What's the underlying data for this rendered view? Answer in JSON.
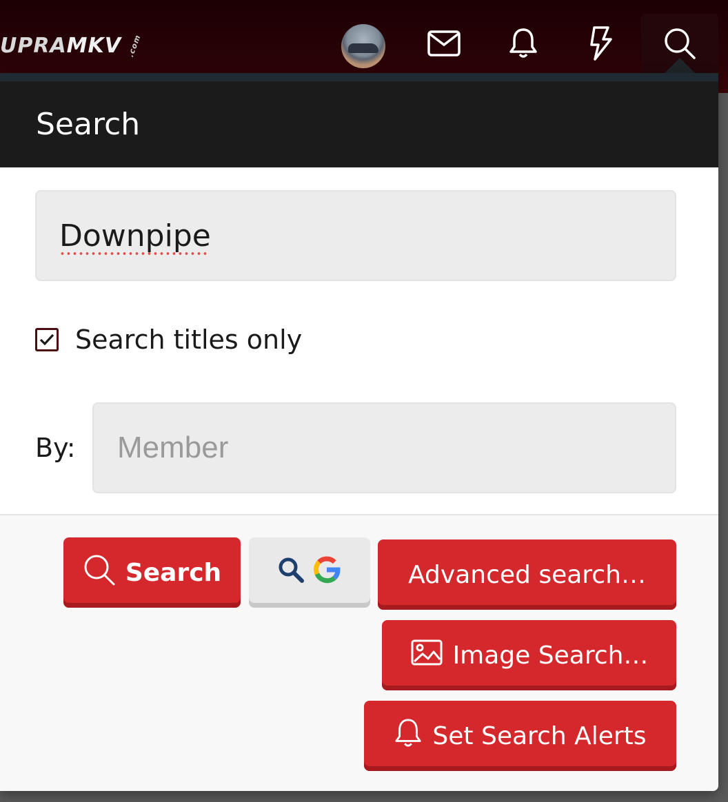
{
  "navbar": {
    "logo_text_a": "UPRA",
    "logo_text_b": "MKV",
    "logo_suffix": ".com",
    "icons": [
      "avatar",
      "envelope-icon",
      "bell-icon",
      "bolt-icon",
      "search-icon"
    ]
  },
  "search_panel": {
    "title": "Search",
    "query_value": "Downpipe",
    "titles_only_label": "Search titles only",
    "titles_only_checked": true,
    "by_label": "By:",
    "member_placeholder": "Member",
    "buttons": {
      "search": "Search",
      "google_search_icons": [
        "search-icon",
        "google-icon"
      ],
      "advanced": "Advanced search…",
      "image_search": "Image Search…",
      "alerts": "Set Search Alerts"
    }
  },
  "colors": {
    "navbar_bg": "#2a0206",
    "panel_header_bg": "#1b1b1b",
    "button_red": "#d4282d",
    "checkbox_border": "#4a0c0f"
  }
}
